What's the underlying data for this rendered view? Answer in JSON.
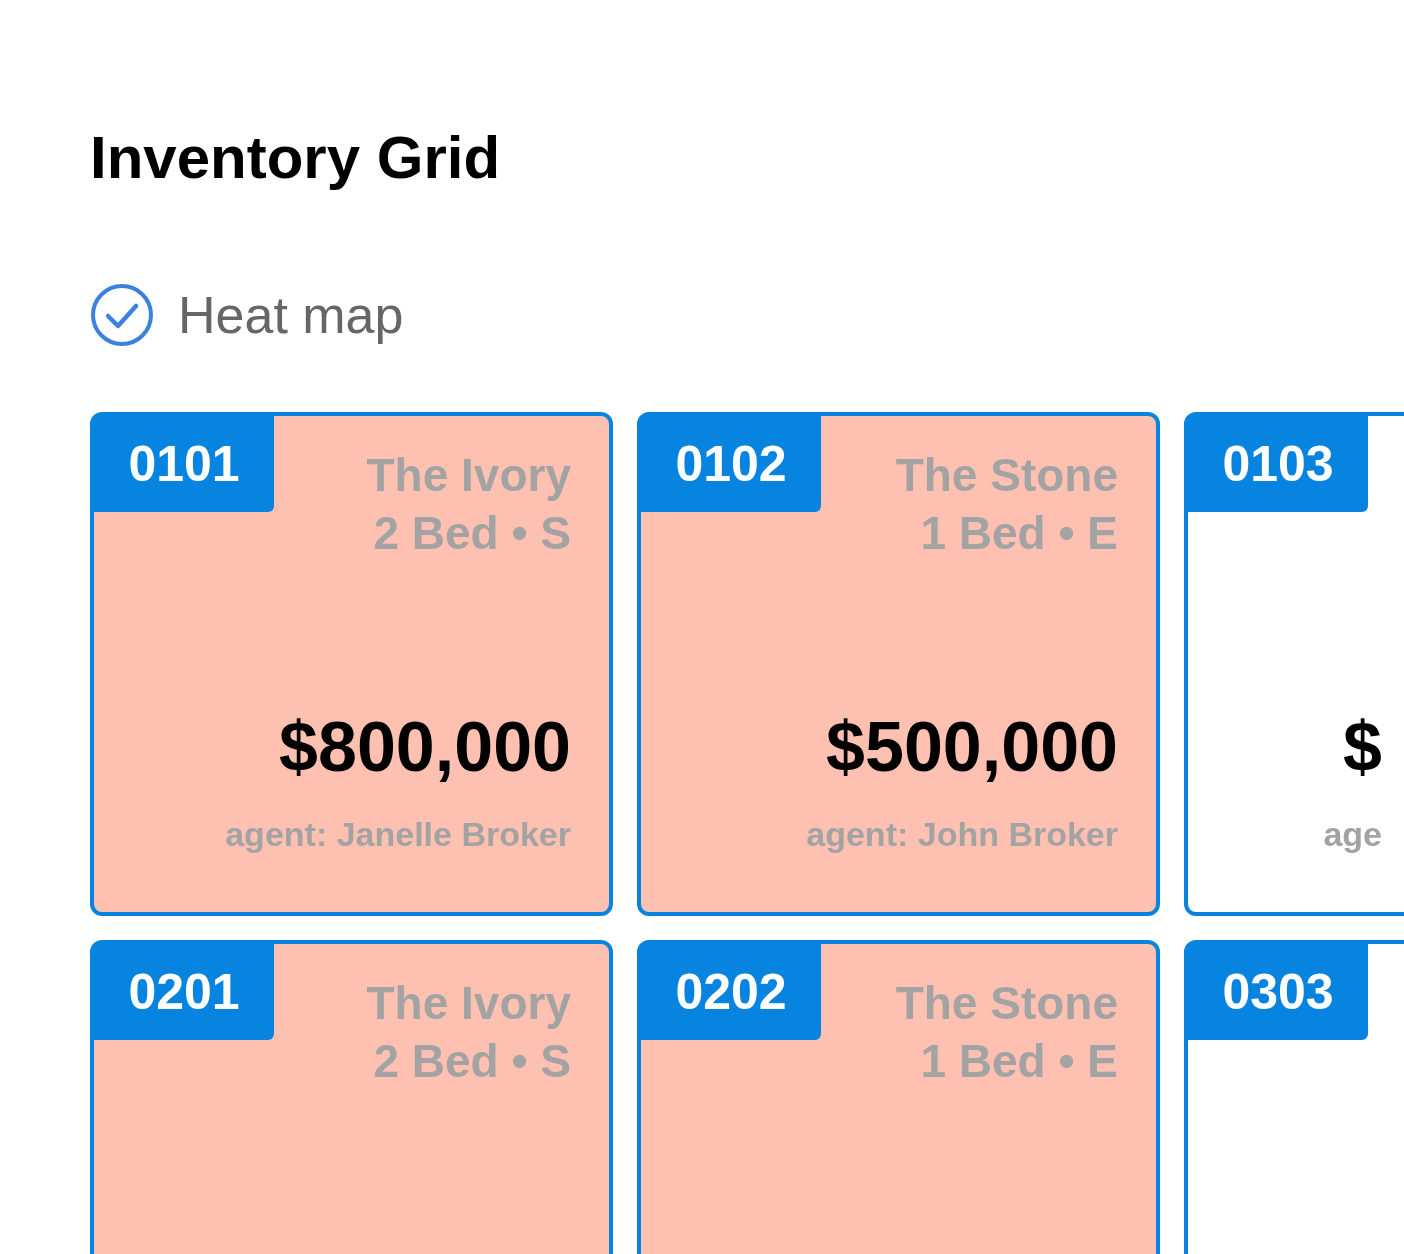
{
  "title": "Inventory Grid",
  "heat_map": {
    "label": "Heat map",
    "checked": true
  },
  "cards": [
    {
      "unit": "0101",
      "building": "The Ivory",
      "layout": "2 Bed • S",
      "price": "$800,000",
      "agent": "agent: Janelle Broker",
      "color": "#fec0b1"
    },
    {
      "unit": "0102",
      "building": "The Stone",
      "layout": "1 Bed • E",
      "price": "$500,000",
      "agent": "agent: John Broker",
      "color": "#fec0b1"
    },
    {
      "unit": "0103",
      "price": "$",
      "agent": "age",
      "color": "#ffffff"
    },
    {
      "unit": "0201",
      "building": "The Ivory",
      "layout": "2 Bed • S",
      "color": "#fec0b1"
    },
    {
      "unit": "0202",
      "building": "The Stone",
      "layout": "1 Bed • E",
      "color": "#fec0b1"
    },
    {
      "unit": "0303",
      "color": "#ffffff"
    }
  ]
}
